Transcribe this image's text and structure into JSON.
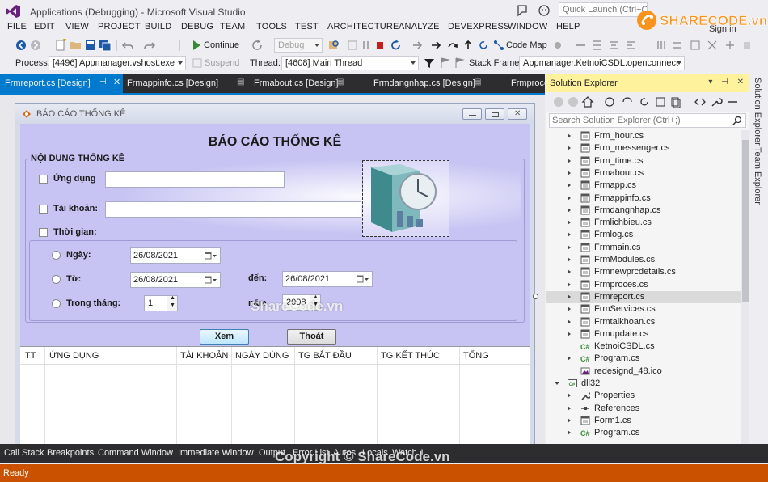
{
  "window": {
    "title": "Applications (Debugging) - Microsoft Visual Studio",
    "quick_launch_placeholder": "Quick Launch (Ctrl+Q)",
    "sign_in": "Sign in"
  },
  "menu": [
    "FILE",
    "EDIT",
    "VIEW",
    "PROJECT",
    "BUILD",
    "DEBUG",
    "TEAM",
    "TOOLS",
    "TEST",
    "ARCHITECTURE",
    "ANALYZE",
    "DEVEXPRESS",
    "WINDOW",
    "HELP"
  ],
  "toolbar": {
    "continue_label": "Continue",
    "config_value": "Debug",
    "code_map_label": "Code Map",
    "process_label": "Process:",
    "process_value": "[4496] Appmanager.vshost.exe",
    "suspend_label": "Suspend",
    "thread_label": "Thread:",
    "thread_value": "[4608] Main Thread",
    "stack_frame_label": "Stack Frame:",
    "stack_frame_value": "Appmanager.KetnoiCSDL.openconnect"
  },
  "doc_tabs": [
    "Frmreport.cs [Design]",
    "Frmappinfo.cs [Design]",
    "Frmabout.cs [Design]",
    "Frmdangnhap.cs [Design]",
    "Frmproce"
  ],
  "form": {
    "title": "BÁO CÁO THỐNG KÊ",
    "heading": "BÁO CÁO THỐNG KÊ",
    "group_label": "NỘI DUNG THỐNG KÊ",
    "chk_app_label": "Ứng dụng",
    "chk_account_label": "Tài khoản:",
    "chk_time_label": "Thời gian:",
    "radio_day_label": "Ngày:",
    "radio_from_label": "Từ:",
    "radio_month_label": "Trong tháng:",
    "to_label": "đến:",
    "year_label": "năm",
    "date_day": "26/08/2021",
    "date_from": "26/08/2021",
    "date_to": "26/08/2021",
    "month_value": "1",
    "year_value": "2008",
    "view_button": "Xem",
    "exit_button": "Thoát",
    "columns": [
      "TT",
      "ỨNG DỤNG",
      "TÀI KHOẢN",
      "NGÀY DÙNG",
      "TG BẮT ĐẦU",
      "TG KẾT THÚC",
      "TỔNG"
    ]
  },
  "solution_explorer": {
    "title": "Solution Explorer",
    "search_placeholder": "Search Solution Explorer (Ctrl+;)",
    "items": [
      {
        "label": "Frm_hour.cs",
        "icon": "form-icon"
      },
      {
        "label": "Frm_messenger.cs",
        "icon": "form-icon"
      },
      {
        "label": "Frm_time.cs",
        "icon": "form-icon"
      },
      {
        "label": "Frmabout.cs",
        "icon": "form-icon"
      },
      {
        "label": "Frmapp.cs",
        "icon": "form-icon"
      },
      {
        "label": "Frmappinfo.cs",
        "icon": "form-icon"
      },
      {
        "label": "Frmdangnhap.cs",
        "icon": "form-icon"
      },
      {
        "label": "Frmlichbieu.cs",
        "icon": "form-icon"
      },
      {
        "label": "Frmlog.cs",
        "icon": "form-icon"
      },
      {
        "label": "Frmmain.cs",
        "icon": "form-icon"
      },
      {
        "label": "FrmModules.cs",
        "icon": "form-icon"
      },
      {
        "label": "Frmnewprcdetails.cs",
        "icon": "form-icon"
      },
      {
        "label": "Frmproces.cs",
        "icon": "form-icon"
      },
      {
        "label": "Frmreport.cs",
        "icon": "form-icon"
      },
      {
        "label": "FrmServices.cs",
        "icon": "form-icon"
      },
      {
        "label": "Frmtaikhoan.cs",
        "icon": "form-icon"
      },
      {
        "label": "Frmupdate.cs",
        "icon": "form-icon"
      },
      {
        "label": "KetnoiCSDL.cs",
        "icon": "csharp-icon"
      },
      {
        "label": "Program.cs",
        "icon": "csharp-icon"
      },
      {
        "label": "redesignd_48.ico",
        "icon": "image-icon"
      },
      {
        "label": "dll32",
        "icon": "project-icon"
      },
      {
        "label": "Properties",
        "icon": "wrench-icon"
      },
      {
        "label": "References",
        "icon": "references-icon"
      },
      {
        "label": "Form1.cs",
        "icon": "form-icon"
      },
      {
        "label": "Program.cs",
        "icon": "csharp-icon"
      }
    ]
  },
  "side_tabs": [
    "Solution Explorer",
    "Team Explorer"
  ],
  "bottom_tabs": [
    "Call Stack",
    "Breakpoints",
    "Command Window",
    "Immediate Window",
    "Output",
    "Error List",
    "Autos",
    "Locals",
    "Watch 1"
  ],
  "status": "Ready",
  "watermarks": {
    "center": "ShareCode.vn",
    "footer": "Copyright © ShareCode.vn",
    "logo": "SHARECODE.vn"
  },
  "colors": {
    "accent": "#007acc",
    "status_bar": "#ca5100",
    "form_client": "#c7c4f3",
    "selection": "#dadada"
  }
}
